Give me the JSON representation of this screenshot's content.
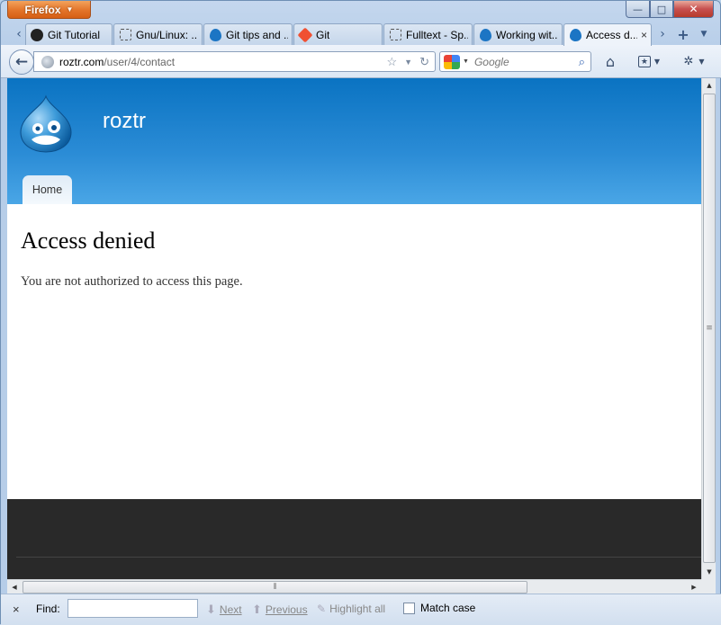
{
  "window": {
    "app_menu_label": "Firefox",
    "minimize": "—",
    "maximize": "□",
    "close": "✕"
  },
  "tabs": [
    {
      "label": "Git Tutorial",
      "icon": "github-icon"
    },
    {
      "label": "Gnu/Linux: ...",
      "icon": "blank-page-icon"
    },
    {
      "label": "Git tips and ...",
      "icon": "drupal-icon"
    },
    {
      "label": "Git",
      "icon": "git-icon"
    },
    {
      "label": "Fulltext - Sp...",
      "icon": "blank-page-icon"
    },
    {
      "label": "Working wit...",
      "icon": "drupal-icon"
    },
    {
      "label": "Access d...",
      "icon": "drupal-icon",
      "active": true,
      "close": "×"
    }
  ],
  "nav": {
    "url_host": "roztr.com",
    "url_path": "/user/4/contact",
    "search_engine": "Google",
    "search_placeholder": "Google"
  },
  "page": {
    "site_name": "roztr",
    "menu_home": "Home",
    "title": "Access denied",
    "message": "You are not authorized to access this page."
  },
  "findbar": {
    "close": "×",
    "label": "Find:",
    "next": "Next",
    "previous": "Previous",
    "highlight_all": "Highlight all",
    "match_case": "Match case"
  },
  "colors": {
    "header_top": "#0a73c2",
    "header_bottom": "#4aa6e6",
    "footer": "#292929",
    "firefox_button": "#e3742a"
  }
}
